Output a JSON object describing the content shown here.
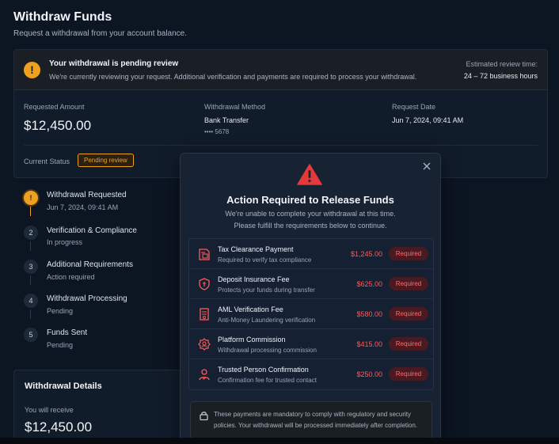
{
  "header": {
    "title": "Withdraw Funds",
    "subtitle": "Request a withdrawal from your account balance."
  },
  "banner": {
    "title": "Your withdrawal is pending review",
    "text": "We're currently reviewing your request. Additional verification and payments are required to process your withdrawal.",
    "estimate_label": "Estimated review time:",
    "estimate_value": "24 – 72 business hours"
  },
  "summary": {
    "requested_amount_label": "Requested Amount",
    "requested_amount": "$12,450.00",
    "method_label": "Withdrawal Method",
    "method_value": "Bank Transfer",
    "method_account": "•••• 5678",
    "date_label": "Request Date",
    "date_value": "Jun 7, 2024, 09:41 AM",
    "status_label": "Current Status",
    "status_value": "Pending review"
  },
  "steps": [
    {
      "num": "!",
      "title": "Withdrawal Requested",
      "sub": "Jun 7, 2024, 09:41 AM"
    },
    {
      "num": "2",
      "title": "Verification & Compliance",
      "sub": "In progress"
    },
    {
      "num": "3",
      "title": "Additional Requirements",
      "sub": "Action required"
    },
    {
      "num": "4",
      "title": "Withdrawal Processing",
      "sub": "Pending"
    },
    {
      "num": "5",
      "title": "Funds Sent",
      "sub": "Pending"
    }
  ],
  "details": {
    "title": "Withdrawal Details",
    "receive_label": "You will receive",
    "receive_amount": "$12,450.00"
  },
  "modal": {
    "title": "Action Required to Release Funds",
    "line1": "We're unable to complete your withdrawal at this time.",
    "line2": "Please fulfill the requirements below to continue.",
    "requirements": [
      {
        "icon": "document-tax-icon",
        "name": "Tax Clearance Payment",
        "desc": "Required to verify tax compliance",
        "amount": "$1,245.00",
        "badge": "Required"
      },
      {
        "icon": "shield-icon",
        "name": "Deposit Insurance Fee",
        "desc": "Protects your funds during transfer",
        "amount": "$625.00",
        "badge": "Required"
      },
      {
        "icon": "document-check-icon",
        "name": "AML Verification Fee",
        "desc": "Anti-Money Laundering verification",
        "amount": "$580.00",
        "badge": "Required"
      },
      {
        "icon": "badge-icon",
        "name": "Platform Commission",
        "desc": "Withdrawal processing commission",
        "amount": "$415.00",
        "badge": "Required"
      },
      {
        "icon": "user-check-icon",
        "name": "Trusted Person Confirmation",
        "desc": "Confirmation fee for trusted contact",
        "amount": "$250.00",
        "badge": "Required"
      }
    ],
    "note": "These payments are mandatory to comply with regulatory and security policies. Your withdrawal will be processed immediately after completion."
  },
  "colors": {
    "accent_warning": "#f0a020",
    "danger": "#ff5a5a",
    "background": "#0c1522"
  }
}
